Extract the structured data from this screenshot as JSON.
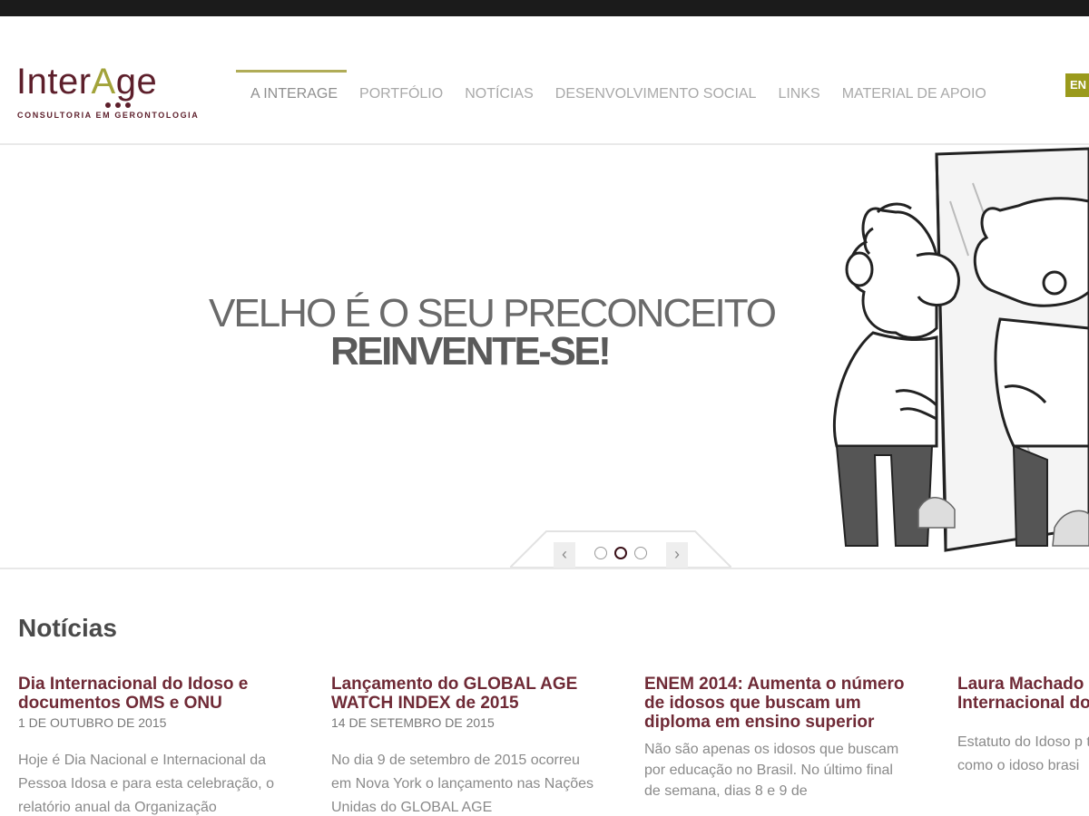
{
  "logo": {
    "word_part1": "Inter",
    "word_a": "A",
    "word_part2": "ge",
    "tagline": "CONSULTORIA EM GERONTOLOGIA"
  },
  "nav": {
    "items": [
      {
        "label": "A INTERAGE",
        "active": true
      },
      {
        "label": "PORTFÓLIO"
      },
      {
        "label": "NOTÍCIAS"
      },
      {
        "label": "DESENVOLVIMENTO SOCIAL"
      },
      {
        "label": "LINKS"
      },
      {
        "label": "MATERIAL DE APOIO"
      }
    ],
    "lang": "EN"
  },
  "hero": {
    "line1": "VELHO É O SEU PRECONCEITO",
    "line2": "REINVENTE-SE!",
    "prev": "‹",
    "next": "›",
    "active_slide": 2,
    "slide_count": 3
  },
  "news": {
    "title": "Notícias",
    "items": [
      {
        "title": "Dia Internacional do Idoso e documentos OMS e ONU",
        "date": "1 DE OUTUBRO DE 2015",
        "excerpt": "Hoje é Dia Nacional e Internacional da Pessoa Idosa e para esta celebração, o relatório anual da Organização"
      },
      {
        "title": "Lançamento do GLOBAL AGE WATCH INDEX de 2015",
        "date": "14 DE SETEMBRO DE 2015",
        "excerpt": "No dia 9 de setembro de 2015 ocorreu em Nova York o lançamento nas Nações Unidas do GLOBAL AGE"
      },
      {
        "title": "ENEM 2014: Aumenta o número de idosos que buscam um diploma em ensino superior",
        "date": "",
        "excerpt": "Não são apenas os idosos que buscam por educação no Brasil. No último final de semana, dias 8 e 9 de"
      },
      {
        "title": "Laura Machado entrevista na Gl Internacional do",
        "date": "",
        "excerpt": "Estatuto do Idoso p terceira idade a div como o idoso brasi"
      }
    ]
  }
}
